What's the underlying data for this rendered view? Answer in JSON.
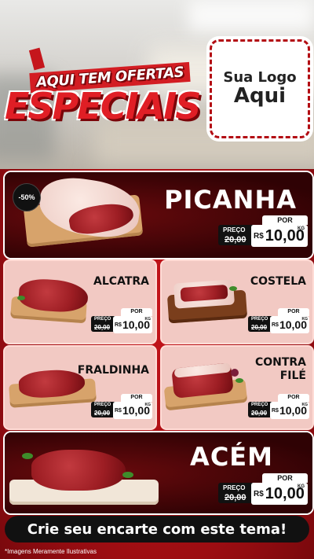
{
  "header": {
    "title_top": "AQUI TEM OFERTAS",
    "title_main": "ESPECIAIS",
    "logo_line1": "Sua Logo",
    "logo_line2": "Aqui"
  },
  "hero": {
    "badge": "-50%",
    "name": "PICANHA",
    "por": "POR",
    "preco_label": "PREÇO",
    "old_price": "20,00",
    "currency": "R$",
    "price": "10,00",
    "unit": "KG"
  },
  "cards": [
    {
      "name": "ALCATRA",
      "por": "POR",
      "preco_label": "PREÇO",
      "old_price": "20,00",
      "currency": "R$",
      "price": "10,00",
      "unit": "KG"
    },
    {
      "name": "COSTELA",
      "por": "POR",
      "preco_label": "PREÇO",
      "old_price": "20,00",
      "currency": "R$",
      "price": "10,00",
      "unit": "KG"
    },
    {
      "name": "FRALDINHA",
      "por": "POR",
      "preco_label": "PREÇO",
      "old_price": "20,00",
      "currency": "R$",
      "price": "10,00",
      "unit": "KG"
    },
    {
      "name_line1": "CONTRA",
      "name_line2": "FILÉ",
      "por": "POR",
      "preco_label": "PREÇO",
      "old_price": "20,00",
      "currency": "R$",
      "price": "10,00",
      "unit": "KG"
    }
  ],
  "acem": {
    "name": "ACÉM",
    "por": "POR",
    "preco_label": "PREÇO",
    "old_price": "20,00",
    "currency": "R$",
    "price": "10,00",
    "unit": "KG"
  },
  "cta": "Crie seu encarte com este tema!",
  "disclaimer": "*Imagens Meramente Ilustrativas",
  "colors": {
    "accent_red": "#c5161c",
    "dark_red": "#3d0406",
    "card_pink": "#f2c9c3"
  }
}
